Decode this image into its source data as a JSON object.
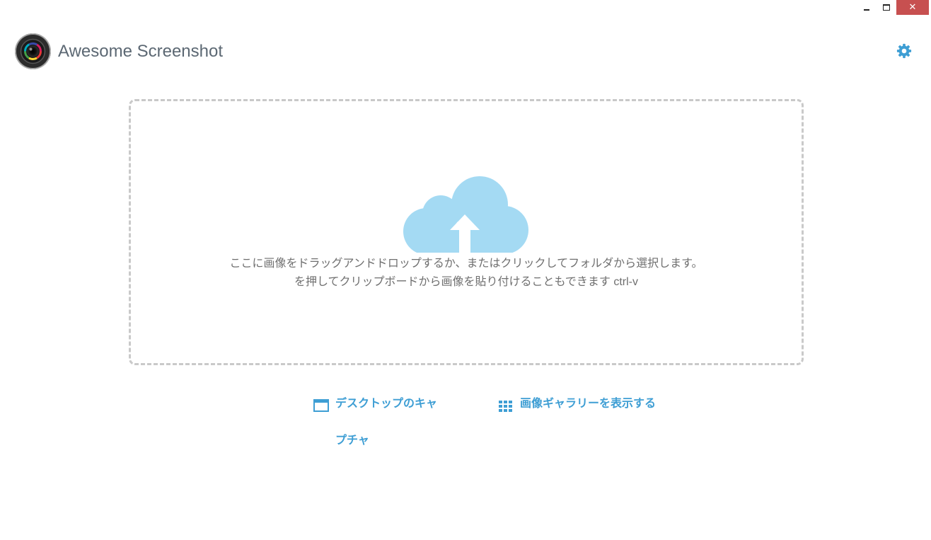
{
  "window": {
    "controls": {
      "minimize_icon": "minimize-icon",
      "maximize_icon": "maximize-icon",
      "close_label": "✕"
    }
  },
  "header": {
    "app_title": "Awesome Screenshot",
    "logo_icon": "camera-lens-icon",
    "settings_icon": "gear-icon"
  },
  "dropzone": {
    "icon": "cloud-upload-icon",
    "line1": "ここに画像をドラッグアンドドロップするか、またはクリックしてフォルダから選択します。",
    "line2": "を押してクリップボードから画像を貼り付けることもできます ctrl-v"
  },
  "actions": {
    "capture_desktop": {
      "label": "デスクトップのキャプチャ",
      "icon": "window-icon"
    },
    "view_gallery": {
      "label": "画像ギャラリーを表示する",
      "icon": "grid-icon"
    }
  },
  "colors": {
    "accent": "#3e9ed4",
    "cloud": "#a4daf3",
    "title_text": "#5c6873",
    "body_text": "#6f6f6f",
    "dashed_border": "#c9c9c9",
    "close_button": "#c75050"
  }
}
